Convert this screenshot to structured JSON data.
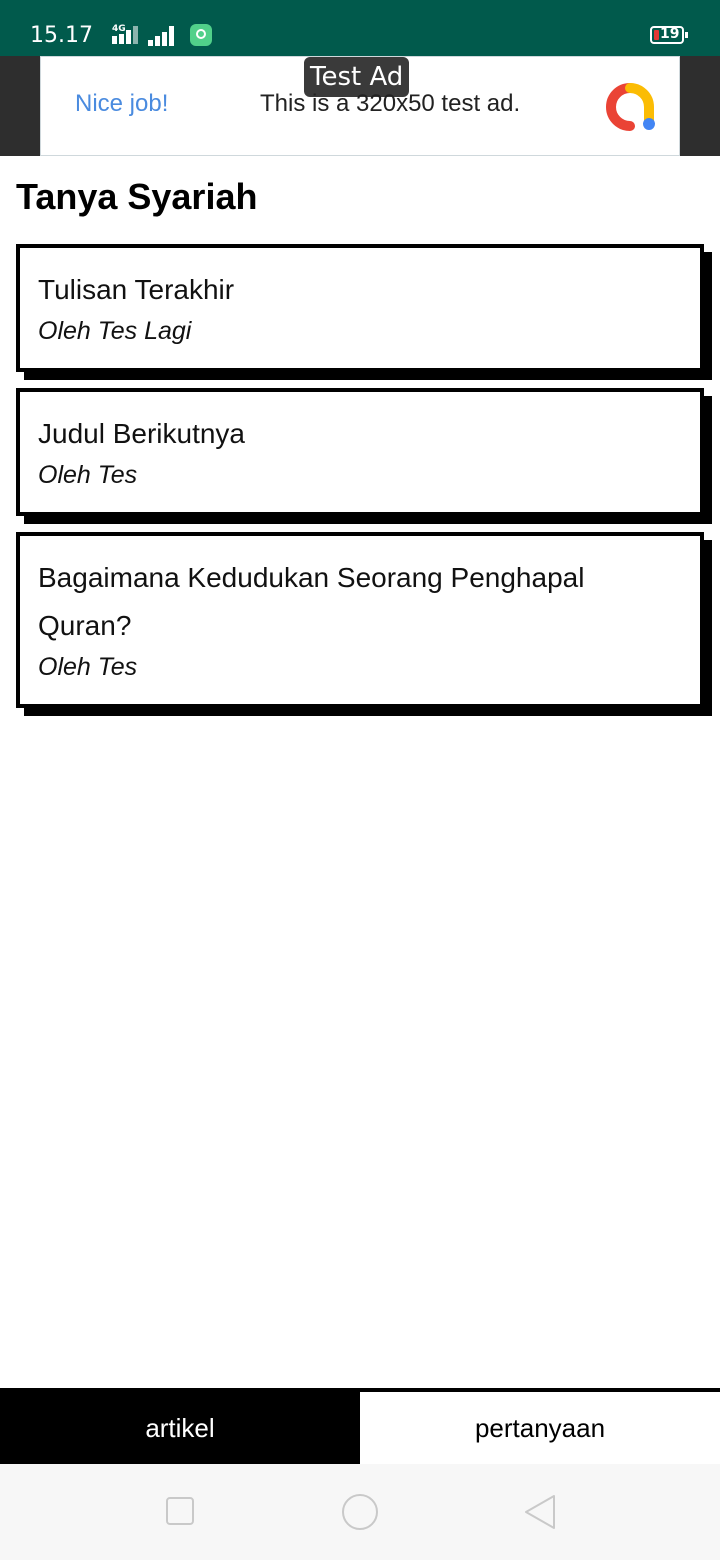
{
  "status_bar": {
    "time": "15.17",
    "network_label": "4G",
    "battery_level": "19",
    "colors": {
      "background": "#015A4C",
      "battery_low": "#E53935"
    }
  },
  "ad": {
    "badge": "Test Ad",
    "headline": "Nice job!",
    "body": "This is a 320x50 test ad.",
    "logo_icon": "ad-logo-icon"
  },
  "page": {
    "title": "Tanya Syariah"
  },
  "articles": [
    {
      "title": "Tulisan Terakhir",
      "author": "Oleh Tes Lagi"
    },
    {
      "title": "Judul Berikutnya",
      "author": "Oleh Tes"
    },
    {
      "title": "Bagaimana Kedudukan Seorang Penghapal Quran?",
      "author": "Oleh Tes"
    }
  ],
  "bottom_nav": {
    "tabs": [
      {
        "label": "artikel",
        "active": true
      },
      {
        "label": "pertanyaan",
        "active": false
      }
    ]
  },
  "system_nav": {
    "icons": [
      "recents-square-icon",
      "home-circle-icon",
      "back-triangle-icon"
    ]
  }
}
